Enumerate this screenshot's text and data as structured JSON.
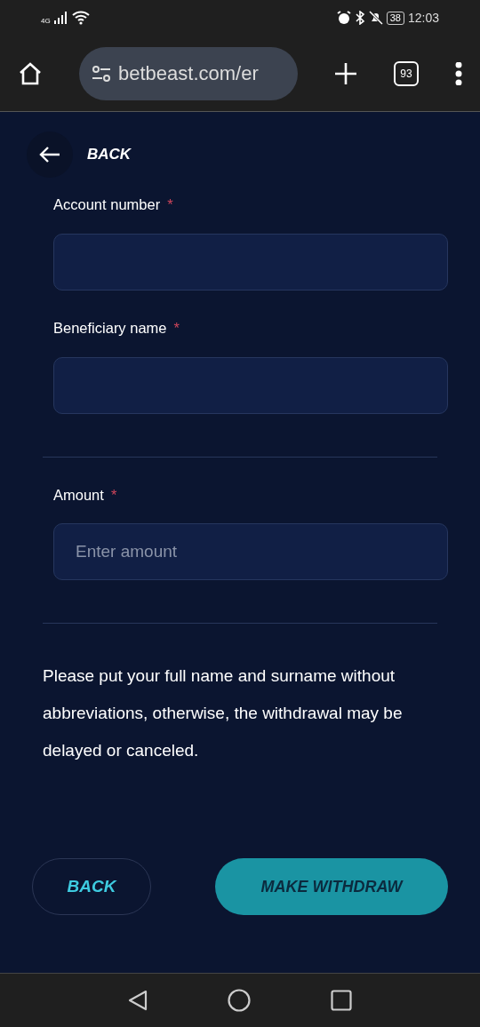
{
  "status_bar": {
    "network": "4G",
    "battery": "38",
    "time": "12:03"
  },
  "browser": {
    "url": "betbeast.com/er",
    "tab_count": "93"
  },
  "header": {
    "back_label": "BACK"
  },
  "fields": [
    {
      "label": "Account number",
      "required": true,
      "divider_after": false
    },
    {
      "label": "Beneficiary name",
      "required": true,
      "divider_after": true
    },
    {
      "label": "Amount",
      "required": true,
      "placeholder": "Enter amount",
      "divider_after": true
    }
  ],
  "note": "Please put your full name and surname without abbreviations, otherwise, the withdrawal may be delayed or canceled.",
  "buttons": [
    {
      "label": "BACK",
      "kind": "outline"
    },
    {
      "label": "MAKE WITHDRAW",
      "kind": "primary"
    }
  ],
  "required_mark": "*"
}
